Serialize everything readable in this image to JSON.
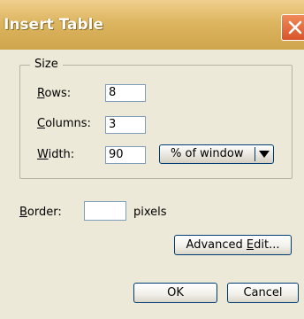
{
  "window": {
    "title": "Insert Table"
  },
  "size_group": {
    "legend": "Size",
    "rows": {
      "label_underlined": "R",
      "label_rest": "ows:",
      "value": "8"
    },
    "columns": {
      "label_underlined": "C",
      "label_rest": "olumns:",
      "value": "3"
    },
    "width": {
      "label_underlined": "W",
      "label_rest": "idth:",
      "value": "90",
      "unit_selected": "% of window"
    }
  },
  "border": {
    "label_underlined": "B",
    "label_rest": "order:",
    "value": "",
    "unit": "pixels"
  },
  "buttons": {
    "advanced_pre": "Advanced ",
    "advanced_underlined": "E",
    "advanced_post": "dit...",
    "ok": "OK",
    "cancel": "Cancel"
  },
  "colors": {
    "titlebar": "#ddb560",
    "dialog_bg": "#ece9d8",
    "close": "#d9532a"
  }
}
